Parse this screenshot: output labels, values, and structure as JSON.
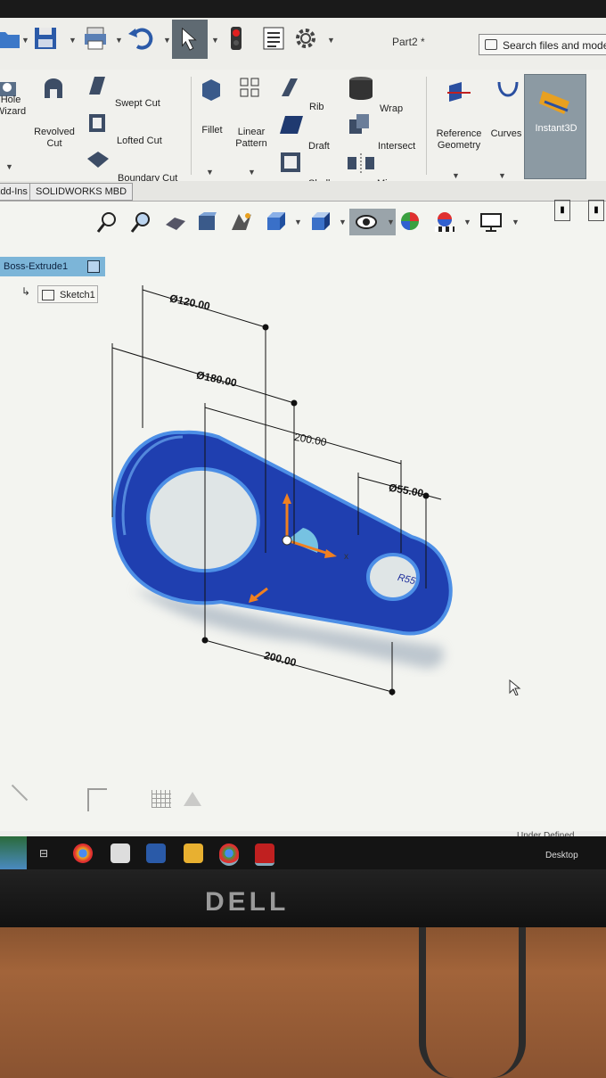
{
  "window": {
    "document_title": "Part2 *"
  },
  "search": {
    "label": "Search files and models"
  },
  "ribbon": {
    "hole_wizard": "Hole\nWizard",
    "revolved_cut": "Revolved\nCut",
    "swept_cut": "Swept Cut",
    "lofted_cut": "Lofted Cut",
    "boundary_cut": "Boundary Cut",
    "fillet": "Fillet",
    "linear_pattern": "Linear\nPattern",
    "rib": "Rib",
    "draft": "Draft",
    "shell": "Shell",
    "wrap": "Wrap",
    "intersect": "Intersect",
    "mirror": "Mirror",
    "reference_geometry": "Reference\nGeometry",
    "curves": "Curves",
    "instant3d": "Instant3D"
  },
  "tabs": [
    "Add-Ins",
    "SOLIDWORKS MBD"
  ],
  "feature_tree": {
    "boss_extrude": "Boss-Extrude1",
    "sketch": "Sketch1"
  },
  "dimensions": {
    "large_hole": "Ø120.00",
    "large_outer": "Ø180.00",
    "center_distance_top": "200.00",
    "small_hole": "Ø55.00",
    "center_distance_bottom": "200.00",
    "small_outer": "R55"
  },
  "status": {
    "state": "Under Defined",
    "desktop": "Desktop"
  },
  "monitor": {
    "brand": "DELL"
  },
  "colors": {
    "part_blue": "#1f3fb0",
    "part_edge": "#4d8fe6",
    "tree_highlight": "#7cb5d8"
  }
}
